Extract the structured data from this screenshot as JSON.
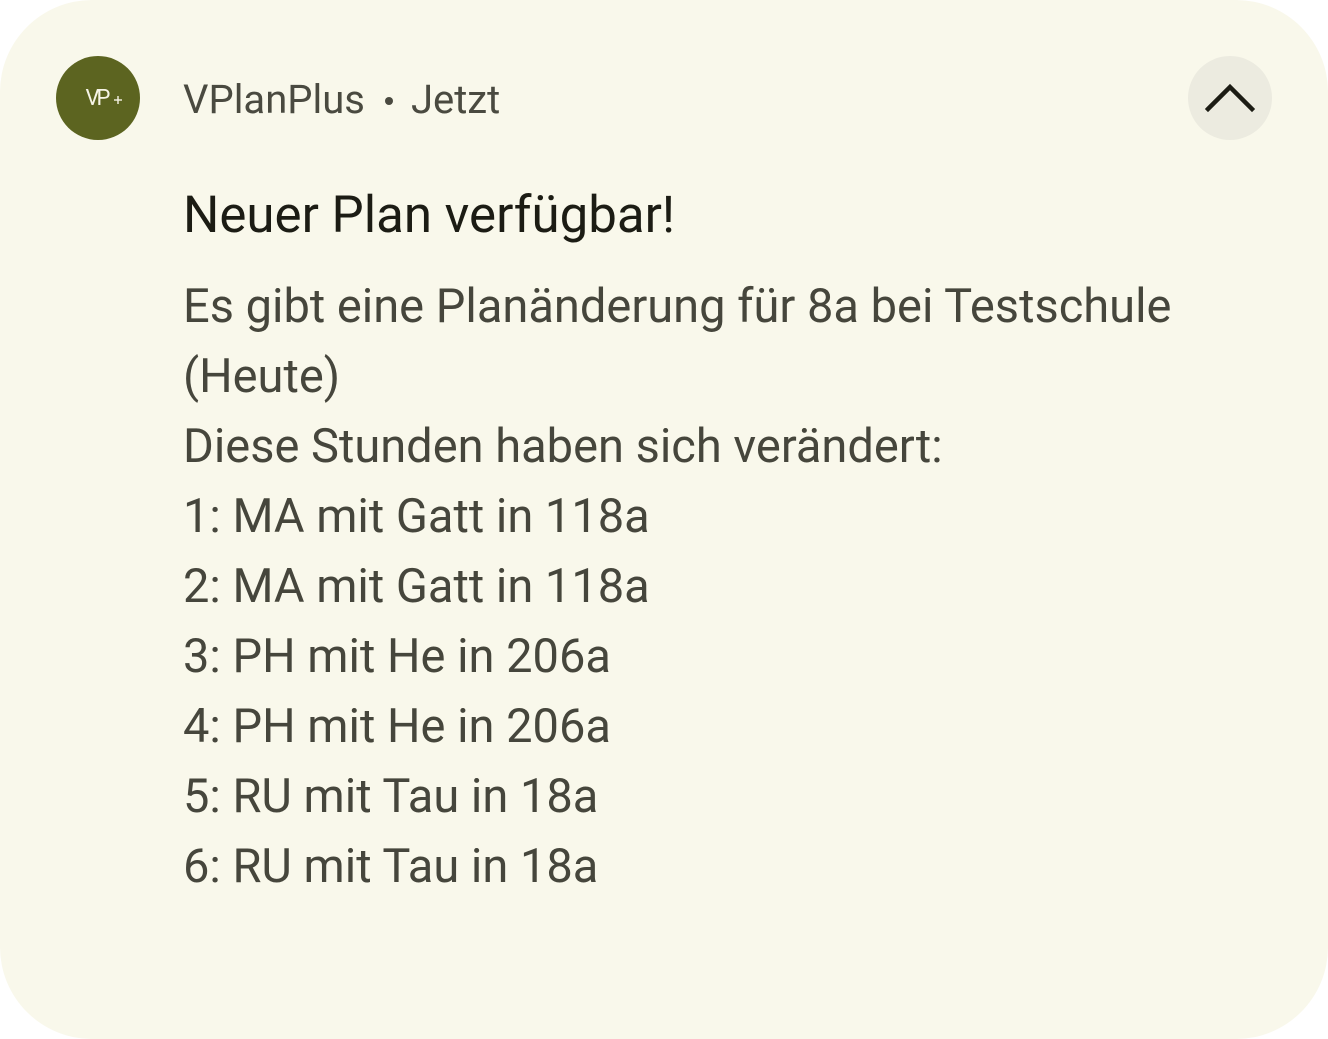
{
  "notification": {
    "app_name": "VPlanPlus",
    "time": "Jetzt",
    "app_icon_text": "VP",
    "title": "Neuer Plan verfügbar!",
    "body_lines": [
      "Es gibt eine Planänderung für 8a bei Testschule",
      "(Heute)",
      "Diese Stunden haben sich verändert:",
      "1: MA mit Gatt in 118a",
      "2: MA mit Gatt in 118a",
      "3: PH mit He in 206a",
      "4: PH mit He in 206a",
      "5: RU mit Tau in 18a",
      "6: RU mit Tau in 18a"
    ],
    "icons": {
      "collapse": "chevron-up-icon",
      "app": "vplanplus-app-icon"
    },
    "colors": {
      "background": "#f9f8eb",
      "app_icon_bg": "#5c6420",
      "collapse_button_bg": "#ecebe0",
      "title": "#1c1c14",
      "body": "#46463c"
    }
  }
}
